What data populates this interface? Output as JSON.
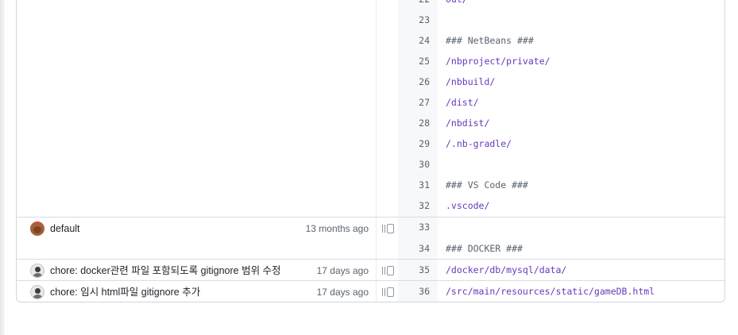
{
  "lines": [
    {
      "num": "22",
      "text": "out/",
      "kind": "path"
    },
    {
      "num": "23",
      "text": "",
      "kind": "plain"
    },
    {
      "num": "24",
      "text": "### NetBeans ###",
      "kind": "comment"
    },
    {
      "num": "25",
      "text": "/nbproject/private/",
      "kind": "path"
    },
    {
      "num": "26",
      "text": "/nbbuild/",
      "kind": "path"
    },
    {
      "num": "27",
      "text": "/dist/",
      "kind": "path"
    },
    {
      "num": "28",
      "text": "/nbdist/",
      "kind": "path"
    },
    {
      "num": "29",
      "text": "/.nb-gradle/",
      "kind": "path"
    },
    {
      "num": "30",
      "text": "",
      "kind": "plain"
    },
    {
      "num": "31",
      "text": "### VS Code ###",
      "kind": "comment"
    },
    {
      "num": "32",
      "text": ".vscode/",
      "kind": "path"
    },
    {
      "num": "33",
      "text": "",
      "kind": "plain"
    },
    {
      "num": "34",
      "text": "### DOCKER ###",
      "kind": "comment"
    },
    {
      "num": "35",
      "text": "/docker/db/mysql/data/",
      "kind": "path"
    },
    {
      "num": "36",
      "text": "/src/main/resources/static/gameDB.html",
      "kind": "path"
    }
  ],
  "commits": [
    {
      "message": "default",
      "age": "13 months ago",
      "avatar": "bear-avatar"
    },
    {
      "message": "chore: docker관련 파일 포함되도록 gitignore 범위 수정",
      "age": "17 days ago",
      "avatar": "person-avatar"
    },
    {
      "message": "chore: 임시 html파일 gitignore 추가",
      "age": "17 days ago",
      "avatar": "person-avatar"
    }
  ],
  "colors": {
    "comment": "#59636e",
    "path": "#6639ba",
    "linenum_bg": "#f6f8fa",
    "border": "#d0d7de"
  },
  "icons": {
    "reblame": "reblame-icon"
  }
}
